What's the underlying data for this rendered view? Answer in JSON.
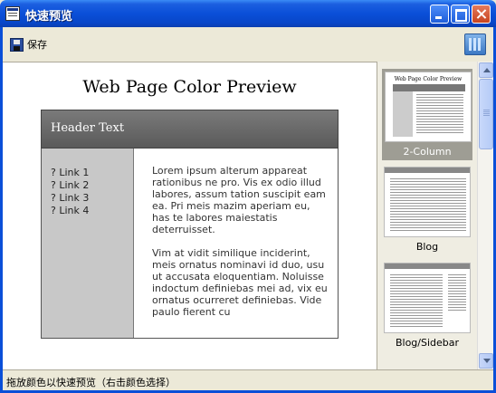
{
  "window": {
    "title": "快速预览",
    "icon": "app-window-icon"
  },
  "toolbar": {
    "save_label": "保存",
    "save_icon": "floppy-disk-icon",
    "view_icon": "layout-view-icon"
  },
  "preview": {
    "page_title": "Web Page Color Preview",
    "header_text": "Header Text",
    "links": [
      "? Link 1",
      "? Link 2",
      "? Link 3",
      "? Link 4"
    ],
    "paragraphs": [
      "Lorem ipsum alterum appareat rationibus ne pro. Vis ex odio illud labores, assum tation suscipit eam ea. Pri meis mazim aperiam eu, has te labores maiestatis deterruisset.",
      "Vim at vidit similique inciderint, meis ornatus nominavi id duo, usu ut accusata eloquentiam. Noluisse indoctum definiebas mei ad, vix eu ornatus ocurreret definiebas. Vide paulo fierent cu"
    ]
  },
  "thumbnails": [
    {
      "label": "2-Column",
      "selected": true,
      "thumb_title": "Web Page Color Preview"
    },
    {
      "label": "Blog",
      "selected": false
    },
    {
      "label": "Blog/Sidebar",
      "selected": false
    }
  ],
  "status": {
    "text": "拖放颜色以快速预览（右击颜色选择）"
  },
  "colors": {
    "titlebar": "#0A4FD8",
    "chrome": "#ECE9D8",
    "header": "#666666",
    "sidebar": "#C8C8C8",
    "selected_thumb": "#9E9D94"
  }
}
